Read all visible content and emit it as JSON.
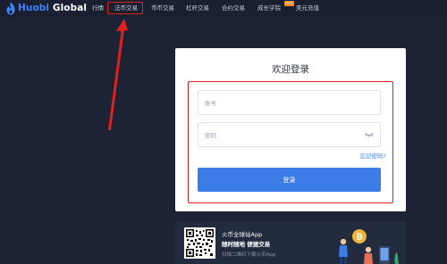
{
  "brand": {
    "logo_text_part1": "Huobi",
    "logo_text_part2": "Global",
    "accent_color": "#3b83f7"
  },
  "nav": {
    "items": [
      {
        "label": "行情"
      },
      {
        "label": "法币交易"
      },
      {
        "label": "币币交易"
      },
      {
        "label": "杠杆交易"
      },
      {
        "label": "合约交易"
      },
      {
        "label": "成长学院"
      },
      {
        "label": "美元充值"
      }
    ],
    "active_index": 1,
    "hot_badge": "HOT"
  },
  "login": {
    "title": "欢迎登录",
    "account_placeholder": "账号",
    "password_placeholder": "密码",
    "forgot_password": "忘记密码?",
    "submit_label": "登录"
  },
  "app_promo": {
    "title": "火币全球站App",
    "subtitle": "随时随地 便捷交易",
    "hint": "扫描二维码下载火币App"
  },
  "icons": {
    "logo": "huobi-flame-logo",
    "password_toggle": "eye-closed-icon",
    "qr": "qr-code",
    "illustration": "crypto-people-illustration"
  },
  "colors": {
    "page_bg": "#1c2334",
    "annotation_red": "#e0201c",
    "button_blue": "#3b7ce6",
    "hot_badge": "#f28a1b",
    "coin_gold": "#f0b33a"
  }
}
